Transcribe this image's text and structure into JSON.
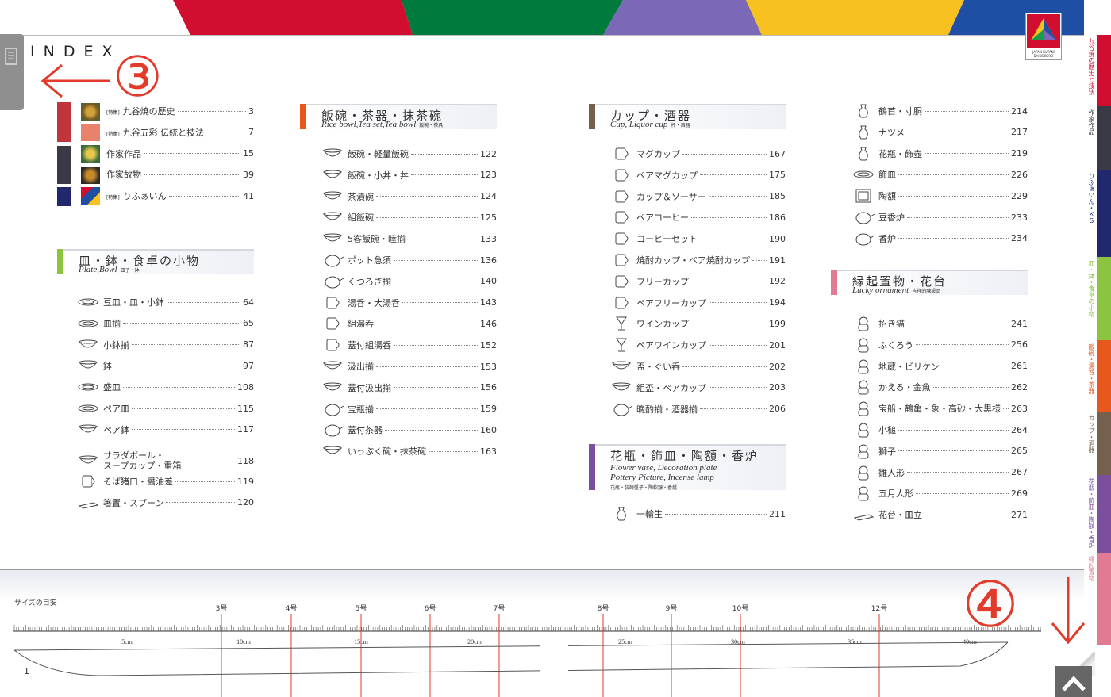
{
  "header": {
    "index_title": "INDEX",
    "bands": [
      "#d10e2f",
      "#007a3d",
      "#7b68b6",
      "#f7c21f",
      "#1e4fa5"
    ],
    "logo_text": "JAPAN KUTANI\nDAIDOKORO"
  },
  "annotations": {
    "left_number": "③",
    "right_number": "④"
  },
  "side_tabs": [
    {
      "label": "九谷焼の歴史と技法",
      "color": "#d10e2f"
    },
    {
      "label": "作家作品",
      "color": "#3a3a46"
    },
    {
      "label": "りふぁいん・ＫＳ",
      "color": "#22286e"
    },
    {
      "label": "皿・鉢・食卓の小物",
      "color": "#8bc53f"
    },
    {
      "label": "飯碗・湯呑・茶器",
      "color": "#e8571e"
    },
    {
      "label": "カップ・酒器",
      "color": "#75604e"
    },
    {
      "label": "花瓶・飾皿・陶額・香炉",
      "color": "#7c4f9d"
    },
    {
      "label": "縁起置物",
      "color": "#e07b93"
    }
  ],
  "col1_top": [
    {
      "tag": "[特集]",
      "label": "九谷焼の歴史",
      "page": "3"
    },
    {
      "tag": "[特集]",
      "label": "九谷五彩 伝統と技法",
      "page": "7"
    },
    {
      "tag": "",
      "label": "作家作品",
      "page": "15"
    },
    {
      "tag": "",
      "label": "作家故物",
      "page": "39"
    },
    {
      "tag": "[特集]",
      "label": "りふぁいん",
      "page": "41"
    }
  ],
  "sections": {
    "plate": {
      "ja": "皿・鉢・食卓の小物",
      "en": "Plate,Bowl",
      "sub": "皿子・鉢",
      "color": "#8bc53f",
      "items": [
        {
          "label": "豆皿・皿・小鉢",
          "page": "64"
        },
        {
          "label": "皿揃",
          "page": "65"
        },
        {
          "label": "小鉢揃",
          "page": "87"
        },
        {
          "label": "鉢",
          "page": "97"
        },
        {
          "label": "盛皿",
          "page": "108"
        },
        {
          "label": "ペア皿",
          "page": "115"
        },
        {
          "label": "ペア鉢",
          "page": "117"
        },
        {
          "label": "サラダボール・",
          "label2": "スープカップ・重箱",
          "page": "118"
        },
        {
          "label": "そば猪口・醤油差",
          "page": "119"
        },
        {
          "label": "箸置・スプーン",
          "page": "120"
        }
      ]
    },
    "rice": {
      "ja": "飯碗・茶器・抹茶碗",
      "en": "Rice bowl,Tea set,Tea bowl",
      "sub": "飯碗・茶具",
      "color": "#e8571e",
      "items": [
        {
          "label": "飯碗・軽量飯碗",
          "page": "122"
        },
        {
          "label": "飯碗・小丼・丼",
          "page": "123"
        },
        {
          "label": "茶漬碗",
          "page": "124"
        },
        {
          "label": "組飯碗",
          "page": "125"
        },
        {
          "label": "5客飯碗・睦揃",
          "page": "133"
        },
        {
          "label": "ポット急須",
          "page": "136"
        },
        {
          "label": "くつろぎ揃",
          "page": "140"
        },
        {
          "label": "湯呑・大湯呑",
          "page": "143"
        },
        {
          "label": "組湯呑",
          "page": "146"
        },
        {
          "label": "蓋付組湯呑",
          "page": "152"
        },
        {
          "label": "汲出揃",
          "page": "153"
        },
        {
          "label": "蓋付汲出揃",
          "page": "156"
        },
        {
          "label": "宝瓶揃",
          "page": "159"
        },
        {
          "label": "蓋付茶器",
          "page": "160"
        },
        {
          "label": "いっぷく碗・抹茶碗",
          "page": "163"
        }
      ]
    },
    "cup": {
      "ja": "カップ・酒器",
      "en": "Cup, Liquor cup",
      "sub": "杯・酒器",
      "color": "#75604e",
      "items": [
        {
          "label": "マグカップ",
          "page": "167"
        },
        {
          "label": "ペアマグカップ",
          "page": "175"
        },
        {
          "label": "カップ＆ソーサー",
          "page": "185"
        },
        {
          "label": "ペアコーヒー",
          "page": "186"
        },
        {
          "label": "コーヒーセット",
          "page": "190"
        },
        {
          "label": "焼酎カップ・ペア焼酎カップ",
          "page": "191"
        },
        {
          "label": "フリーカップ",
          "page": "192"
        },
        {
          "label": "ペアフリーカップ",
          "page": "194"
        },
        {
          "label": "ワインカップ",
          "page": "199"
        },
        {
          "label": "ペアワインカップ",
          "page": "201"
        },
        {
          "label": "盃・ぐい呑",
          "page": "202"
        },
        {
          "label": "組盃・ペアカップ",
          "page": "203"
        },
        {
          "label": "晩酌揃・酒器揃",
          "page": "206"
        }
      ]
    },
    "vase": {
      "ja": "花瓶・飾皿・陶額・香炉",
      "en": "Flower vase, Decoration plate",
      "en2": "Pottery Picture, Incense lamp",
      "sub": "花瓶・装飾盤子・陶軟額・香爐",
      "color": "#7c4f9d",
      "items": [
        {
          "label": "一輪生",
          "page": "211"
        }
      ]
    },
    "vase_cont": {
      "items": [
        {
          "label": "鶴首・寸胴",
          "page": "214"
        },
        {
          "label": "ナツメ",
          "page": "217"
        },
        {
          "label": "花瓶・飾壺",
          "page": "219"
        },
        {
          "label": "飾皿",
          "page": "226"
        },
        {
          "label": "陶額",
          "page": "229"
        },
        {
          "label": "豆香炉",
          "page": "233"
        },
        {
          "label": "香炉",
          "page": "234"
        }
      ]
    },
    "lucky": {
      "ja": "縁起置物・花台",
      "en": "Lucky ornament",
      "sub": "吉祥的陳設品",
      "color": "#e07b93",
      "items": [
        {
          "label": "招き猫",
          "page": "241"
        },
        {
          "label": "ふくろう",
          "page": "256"
        },
        {
          "label": "地蔵・ビリケン",
          "page": "261"
        },
        {
          "label": "かえる・金魚",
          "page": "262"
        },
        {
          "label": "宝船・鶴亀・象・高砂・大黒様",
          "page": "263"
        },
        {
          "label": "小槌",
          "page": "264"
        },
        {
          "label": "獅子",
          "page": "265"
        },
        {
          "label": "雛人形",
          "page": "267"
        },
        {
          "label": "五月人形",
          "page": "269"
        },
        {
          "label": "花台・皿立",
          "page": "271"
        }
      ]
    }
  },
  "ruler": {
    "title": "サイズの目安",
    "sizes": [
      "3号",
      "4号",
      "5号",
      "6号",
      "7号",
      "8号",
      "9号",
      "10号",
      "12号"
    ],
    "cm": [
      "5cm",
      "10cm",
      "15cm",
      "20cm",
      "25cm",
      "30cm",
      "35cm",
      "40cm"
    ]
  },
  "page_number": "1"
}
